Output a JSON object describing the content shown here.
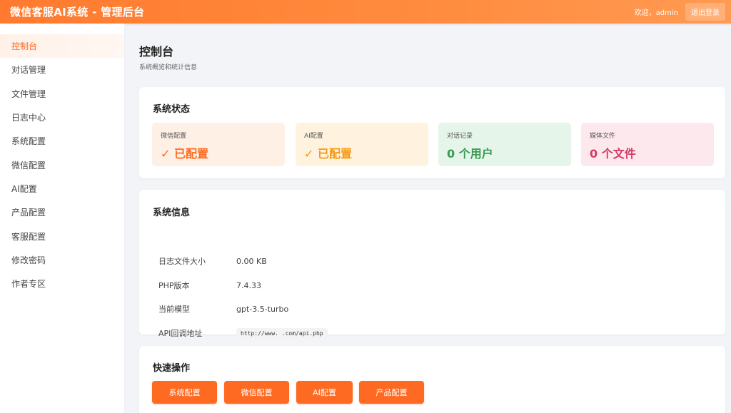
{
  "header": {
    "title": "微信客服AI系统 - 管理后台",
    "welcome": "欢迎，admin",
    "logout_label": "退出登录"
  },
  "sidebar": {
    "items": [
      {
        "label": "控制台"
      },
      {
        "label": "对话管理"
      },
      {
        "label": "文件管理"
      },
      {
        "label": "日志中心"
      },
      {
        "label": "系统配置"
      },
      {
        "label": "微信配置"
      },
      {
        "label": "AI配置"
      },
      {
        "label": "产品配置"
      },
      {
        "label": "客服配置"
      },
      {
        "label": "修改密码"
      },
      {
        "label": "作者专区"
      }
    ]
  },
  "page": {
    "title": "控制台",
    "subtitle": "系统概览和统计信息"
  },
  "status": {
    "title": "系统状态",
    "boxes": [
      {
        "label": "微信配置",
        "value": "✓ 已配置"
      },
      {
        "label": "AI配置",
        "value": "✓ 已配置"
      },
      {
        "label": "对话记录",
        "value": "0 个用户"
      },
      {
        "label": "媒体文件",
        "value": "0 个文件"
      }
    ]
  },
  "info": {
    "title": "系统信息",
    "rows": [
      {
        "key": "日志文件大小",
        "value": "0.00 KB"
      },
      {
        "key": "PHP版本",
        "value": "7.4.33"
      },
      {
        "key": "当前模型",
        "value": "gpt-3.5-turbo"
      },
      {
        "key": "API回调地址",
        "value": "http://www.     .com/api.php"
      }
    ]
  },
  "quick": {
    "title": "快速操作",
    "buttons": [
      {
        "label": "系统配置"
      },
      {
        "label": "微信配置"
      },
      {
        "label": "AI配置"
      },
      {
        "label": "产品配置"
      }
    ]
  },
  "colors": {
    "accent": "#ff6a22",
    "header_gradient_start": "#ff7a2f",
    "header_gradient_end": "#ff9a52"
  }
}
